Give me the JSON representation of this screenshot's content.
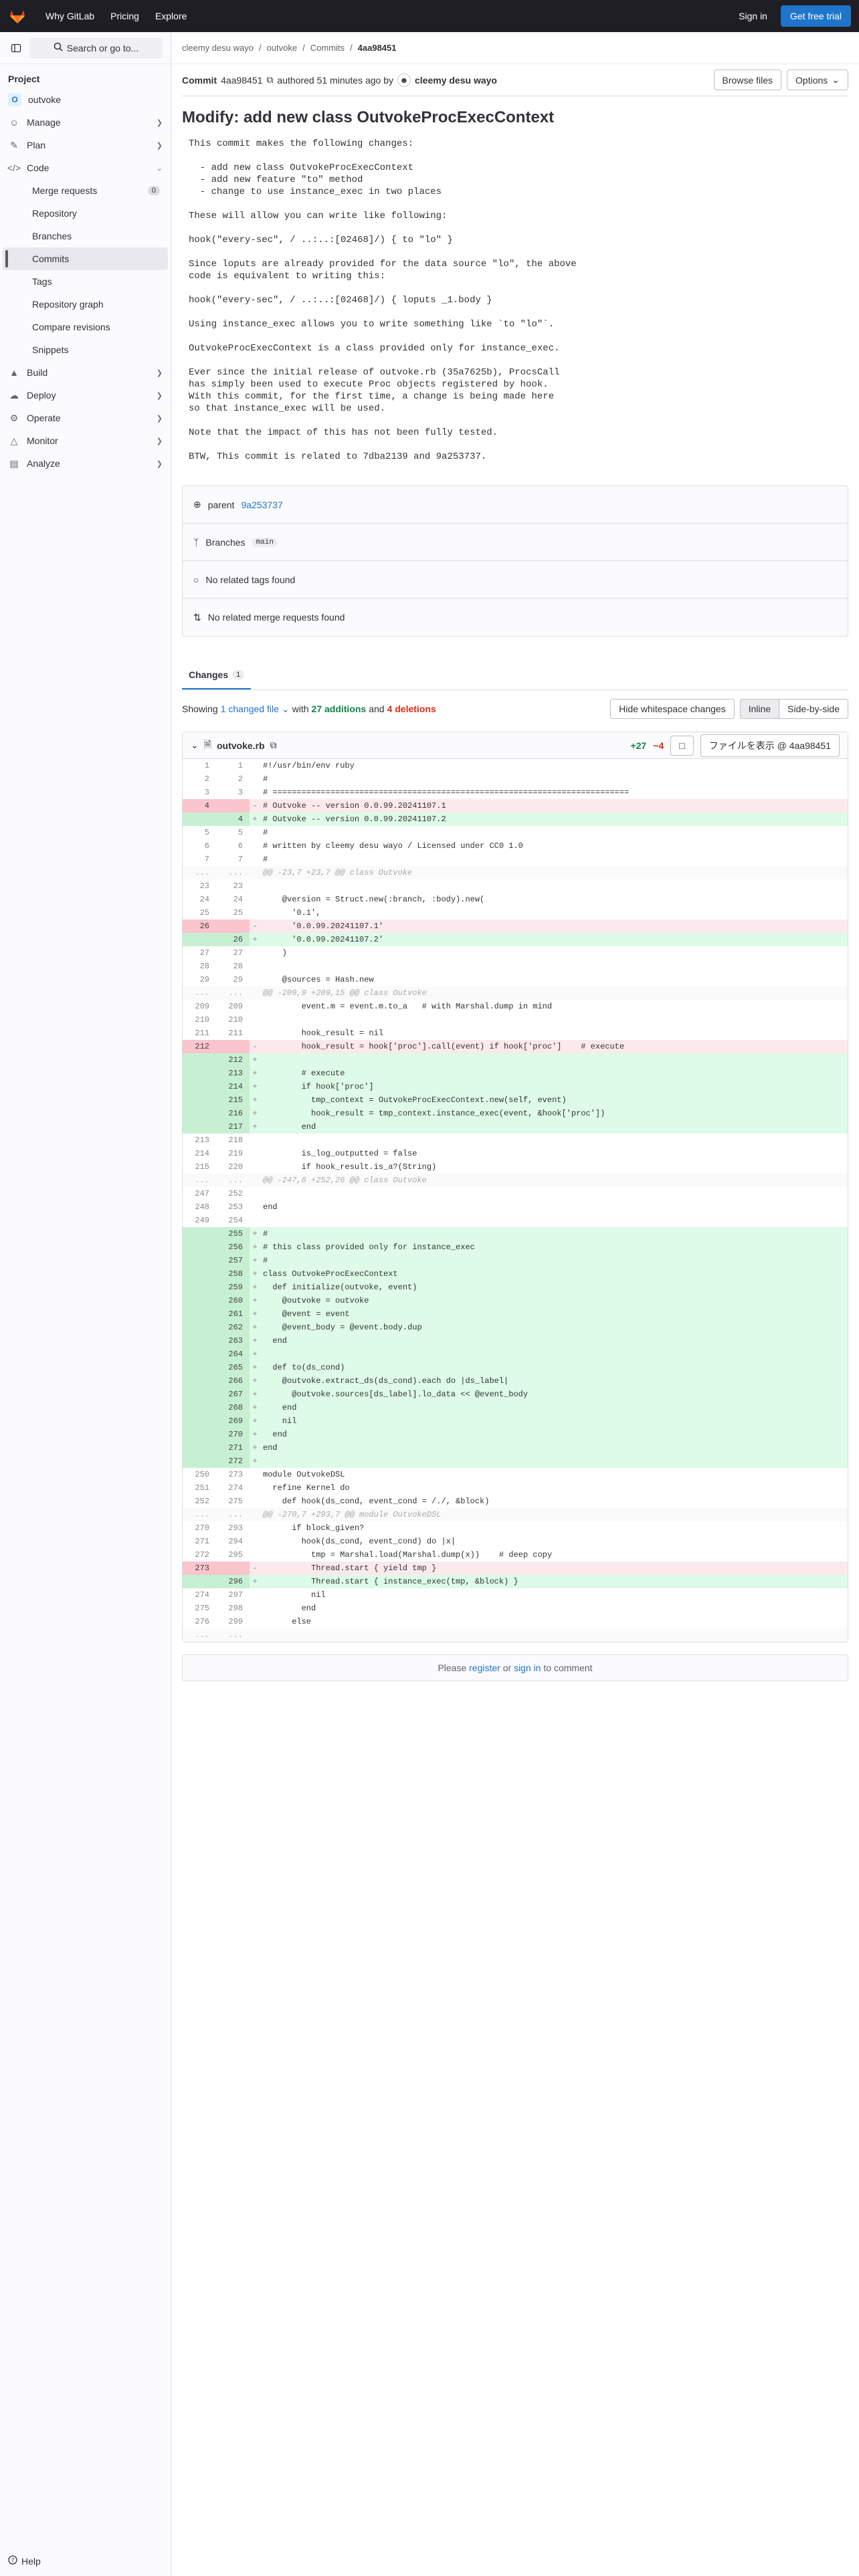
{
  "topbar": {
    "nav": [
      "Why GitLab",
      "Pricing",
      "Explore"
    ],
    "signin": "Sign in",
    "trial": "Get free trial",
    "brand_color": "#fc6d26"
  },
  "sidebar": {
    "search": "Search or go to...",
    "section": "Project",
    "project": {
      "badge": "O",
      "name": "outvoke"
    },
    "items": [
      {
        "label": "Manage",
        "icon": "users-icon"
      },
      {
        "label": "Plan",
        "icon": "plan-icon"
      },
      {
        "label": "Code",
        "icon": "code-icon"
      }
    ],
    "code_sub": [
      {
        "label": "Merge requests",
        "count": "0"
      },
      {
        "label": "Repository"
      },
      {
        "label": "Branches"
      },
      {
        "label": "Commits",
        "active": true
      },
      {
        "label": "Tags"
      },
      {
        "label": "Repository graph"
      },
      {
        "label": "Compare revisions"
      },
      {
        "label": "Snippets"
      }
    ],
    "items2": [
      {
        "label": "Build"
      },
      {
        "label": "Deploy"
      },
      {
        "label": "Operate"
      },
      {
        "label": "Monitor"
      },
      {
        "label": "Analyze"
      }
    ],
    "help": "Help"
  },
  "breadcrumb": [
    "cleemy desu wayo",
    "outvoke",
    "Commits",
    "4aa98451"
  ],
  "commit": {
    "label": "Commit",
    "sha": "4aa98451",
    "authored": "authored 51 minutes ago by",
    "author": "cleemy desu wayo",
    "browse": "Browse files",
    "options": "Options",
    "title": "Modify: add new class OutvokeProcExecContext",
    "message_lines": [
      "This commit makes the following changes:",
      "",
      "  - add new class OutvokeProcExecContext",
      "  - add new feature \"to\" method",
      "  - change to use instance_exec in two places",
      "",
      "These will allow you can write like following:",
      "",
      "hook(\"every-sec\", / ..:..:[02468]/) { to \"lo\" }",
      "",
      "Since loputs are already provided for the data source \"lo\", the above",
      "code is equivalent to writing this:",
      "",
      "hook(\"every-sec\", / ..:..:[02468]/) { loputs _1.body }",
      "",
      "Using instance_exec allows you to write something like `to \"lo\"`.",
      "",
      "OutvokeProcExecContext is a class provided only for instance_exec.",
      "",
      "Ever since the initial release of outvoke.rb (35a7625b), ProcsCall",
      "has simply been used to execute Proc objects registered by hook.",
      "With this commit, for the first time, a change is being made here",
      "so that instance_exec will be used.",
      "",
      "Note that the impact of this has not been fully tested.",
      "",
      "BTW, This commit is related to 7dba2139 and 9a253737."
    ],
    "parent_label": "parent",
    "parent": "9a253737",
    "branches_label": "Branches",
    "branch": "main",
    "no_tags": "No related tags found",
    "no_mrs": "No related merge requests found"
  },
  "changes": {
    "tab": "Changes",
    "count": "1",
    "showing": "Showing",
    "changed_file": "1 changed file",
    "with": "with",
    "additions": "27 additions",
    "and": "and",
    "deletions": "4 deletions",
    "hide_ws": "Hide whitespace changes",
    "inline": "Inline",
    "side": "Side-by-side",
    "file": "outvoke.rb",
    "plus": "+27",
    "minus": "−4",
    "view_file": "ファイルを表示 @ 4aa98451"
  },
  "diff": [
    [
      "n",
      "1",
      "1",
      "#!/usr/bin/env ruby"
    ],
    [
      "n",
      "2",
      "2",
      "#"
    ],
    [
      "n",
      "3",
      "3",
      "# =========================================================================="
    ],
    [
      "d",
      "4",
      "",
      "# Outvoke -- version 0.0.99.20241107.1"
    ],
    [
      "a",
      "",
      "4",
      "# Outvoke -- version 0.0.99.20241107.2"
    ],
    [
      "n",
      "5",
      "5",
      "#"
    ],
    [
      "n",
      "6",
      "6",
      "# written by cleemy desu wayo / Licensed under CC0 1.0"
    ],
    [
      "n",
      "7",
      "7",
      "#"
    ],
    [
      "h",
      "...",
      "...",
      "@@ -23,7 +23,7 @@ class Outvoke"
    ],
    [
      "n",
      "23",
      "23",
      ""
    ],
    [
      "n",
      "24",
      "24",
      "    @version = Struct.new(:branch, :body).new("
    ],
    [
      "n",
      "25",
      "25",
      "      '0.1',"
    ],
    [
      "d",
      "26",
      "",
      "      '0.0.99.20241107.1'"
    ],
    [
      "a",
      "",
      "26",
      "      '0.0.99.20241107.2'"
    ],
    [
      "n",
      "27",
      "27",
      "    )"
    ],
    [
      "n",
      "28",
      "28",
      ""
    ],
    [
      "n",
      "29",
      "29",
      "    @sources = Hash.new"
    ],
    [
      "h",
      "...",
      "...",
      "@@ -209,9 +209,15 @@ class Outvoke"
    ],
    [
      "n",
      "209",
      "209",
      "        event.m = event.m.to_a   # with Marshal.dump in mind"
    ],
    [
      "n",
      "210",
      "210",
      ""
    ],
    [
      "n",
      "211",
      "211",
      "        hook_result = nil"
    ],
    [
      "d",
      "212",
      "",
      "        hook_result = hook['proc'].call(event) if hook['proc']    # execute"
    ],
    [
      "a",
      "",
      "212",
      ""
    ],
    [
      "a",
      "",
      "213",
      "        # execute"
    ],
    [
      "a",
      "",
      "214",
      "        if hook['proc']"
    ],
    [
      "a",
      "",
      "215",
      "          tmp_context = OutvokeProcExecContext.new(self, event)"
    ],
    [
      "a",
      "",
      "216",
      "          hook_result = tmp_context.instance_exec(event, &hook['proc'])"
    ],
    [
      "a",
      "",
      "217",
      "        end"
    ],
    [
      "n",
      "213",
      "218",
      ""
    ],
    [
      "n",
      "214",
      "219",
      "        is_log_outputted = false"
    ],
    [
      "n",
      "215",
      "220",
      "        if hook_result.is_a?(String)"
    ],
    [
      "h",
      "...",
      "...",
      "@@ -247,6 +252,26 @@ class Outvoke"
    ],
    [
      "n",
      "247",
      "252",
      ""
    ],
    [
      "n",
      "248",
      "253",
      "end"
    ],
    [
      "n",
      "249",
      "254",
      ""
    ],
    [
      "a",
      "",
      "255",
      "#"
    ],
    [
      "a",
      "",
      "256",
      "# this class provided only for instance_exec"
    ],
    [
      "a",
      "",
      "257",
      "#"
    ],
    [
      "a",
      "",
      "258",
      "class OutvokeProcExecContext"
    ],
    [
      "a",
      "",
      "259",
      "  def initialize(outvoke, event)"
    ],
    [
      "a",
      "",
      "260",
      "    @outvoke = outvoke"
    ],
    [
      "a",
      "",
      "261",
      "    @event = event"
    ],
    [
      "a",
      "",
      "262",
      "    @event_body = @event.body.dup"
    ],
    [
      "a",
      "",
      "263",
      "  end"
    ],
    [
      "a",
      "",
      "264",
      ""
    ],
    [
      "a",
      "",
      "265",
      "  def to(ds_cond)"
    ],
    [
      "a",
      "",
      "266",
      "    @outvoke.extract_ds(ds_cond).each do |ds_label|"
    ],
    [
      "a",
      "",
      "267",
      "      @outvoke.sources[ds_label].lo_data << @event_body"
    ],
    [
      "a",
      "",
      "268",
      "    end"
    ],
    [
      "a",
      "",
      "269",
      "    nil"
    ],
    [
      "a",
      "",
      "270",
      "  end"
    ],
    [
      "a",
      "",
      "271",
      "end"
    ],
    [
      "a",
      "",
      "272",
      ""
    ],
    [
      "n",
      "250",
      "273",
      "module OutvokeDSL"
    ],
    [
      "n",
      "251",
      "274",
      "  refine Kernel do"
    ],
    [
      "n",
      "252",
      "275",
      "    def hook(ds_cond, event_cond = /./, &block)"
    ],
    [
      "h",
      "...",
      "...",
      "@@ -270,7 +293,7 @@ module OutvokeDSL"
    ],
    [
      "n",
      "270",
      "293",
      "      if block_given?"
    ],
    [
      "n",
      "271",
      "294",
      "        hook(ds_cond, event_cond) do |x|"
    ],
    [
      "n",
      "272",
      "295",
      "          tmp = Marshal.load(Marshal.dump(x))    # deep copy"
    ],
    [
      "d",
      "273",
      "",
      "          Thread.start { yield tmp }"
    ],
    [
      "a",
      "",
      "296",
      "          Thread.start { instance_exec(tmp, &block) }"
    ],
    [
      "n",
      "274",
      "297",
      "          nil"
    ],
    [
      "n",
      "275",
      "298",
      "        end"
    ],
    [
      "n",
      "276",
      "299",
      "      else"
    ],
    [
      "h",
      "...",
      "...",
      ""
    ]
  ],
  "footer": {
    "please": "Please",
    "register": "register",
    "or": "or",
    "signin": "sign in",
    "to_comment": "to comment"
  }
}
